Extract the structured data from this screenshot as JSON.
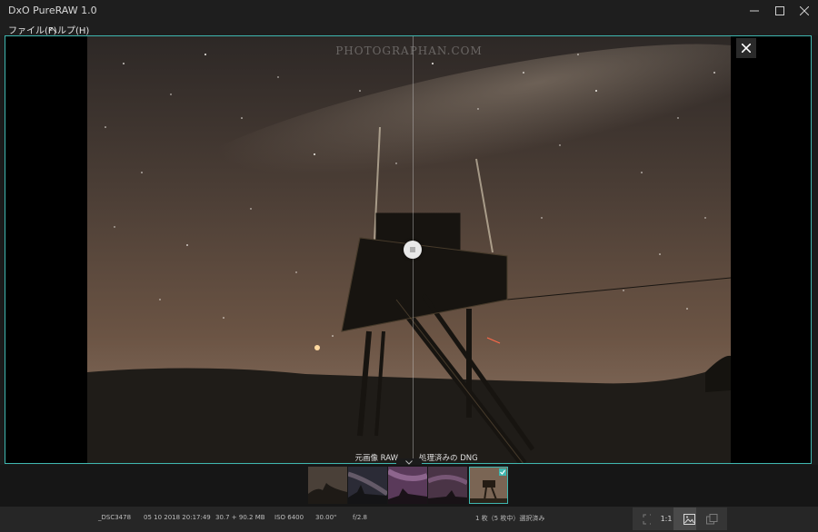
{
  "window": {
    "title": "DxO PureRAW 1.0"
  },
  "menu": {
    "items": [
      "ファイル(F)",
      "ヘルプ(H)"
    ]
  },
  "viewer": {
    "watermark": "PHOTOGRAPHAN.COM",
    "label_left": "元画像 RAW",
    "label_right": "処理済みの DNG"
  },
  "status": {
    "filename": "_DSC3478",
    "datetime": "05 10 2018 20:17:49",
    "filesize": "30.7 + 90.2 MB",
    "iso": "ISO 6400",
    "shutter": "30.00\"",
    "aperture": "f/2.8",
    "selection": "1 枚（5 枚中）選択済み",
    "zoom_label": "1:1"
  },
  "icons": [
    "minimize-icon",
    "maximize-icon",
    "close-icon",
    "split-handle-icon",
    "chevron-down-icon",
    "check-icon",
    "fit-icon",
    "split-view-icon",
    "side-by-side-icon"
  ],
  "colors": {
    "accent": "#3fb7b0",
    "background": "#1b1b1b"
  }
}
